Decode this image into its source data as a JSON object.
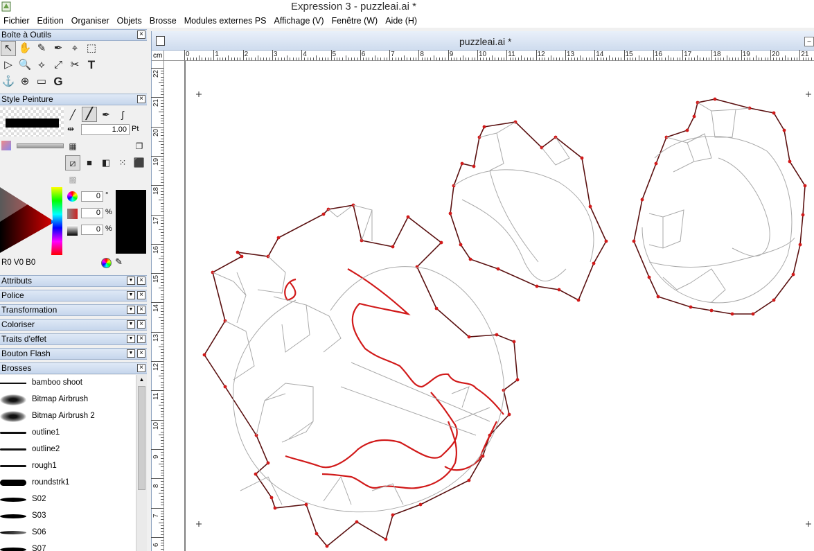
{
  "window": {
    "title": "Expression 3 - puzzleai.ai *"
  },
  "menu": [
    "Fichier",
    "Edition",
    "Organiser",
    "Objets",
    "Brosse",
    "Modules externes PS",
    "Affichage (V)",
    "Fenêtre (W)",
    "Aide (H)"
  ],
  "toolbox": {
    "title": "Boîte à Outils",
    "tools": [
      {
        "name": "selection-arrow-icon",
        "glyph": "↖"
      },
      {
        "name": "hand-icon",
        "glyph": "✋"
      },
      {
        "name": "brush-icon",
        "glyph": "✎"
      },
      {
        "name": "pen-icon",
        "glyph": "✒"
      },
      {
        "name": "add-node-icon",
        "glyph": "⌖"
      },
      {
        "name": "marquee-icon",
        "glyph": "⬚"
      },
      {
        "name": "direct-select-icon",
        "glyph": "▷"
      },
      {
        "name": "zoom-icon",
        "glyph": "🔍"
      },
      {
        "name": "node-edit-icon",
        "glyph": "⟡"
      },
      {
        "name": "transform-icon",
        "glyph": "⤢"
      },
      {
        "name": "scissors-icon",
        "glyph": "✂"
      },
      {
        "name": "text-icon",
        "glyph": "T"
      },
      {
        "name": "anchor-icon",
        "glyph": "⚓"
      },
      {
        "name": "magnifier-plus-icon",
        "glyph": "⊕"
      },
      {
        "name": "rectangle-icon",
        "glyph": "▭"
      },
      {
        "name": "rotate-icon",
        "glyph": "G"
      }
    ]
  },
  "style": {
    "title": "Style Peinture",
    "stroke_width": "1.00",
    "stroke_unit": "Pt",
    "hue_value": "0",
    "hue_unit": "°",
    "sat_value": "0",
    "sat_unit": "%",
    "lum_value": "0",
    "lum_unit": "%",
    "rgb": "R0  V0  B0",
    "current_color": "#000000"
  },
  "panels": [
    "Attributs",
    "Police",
    "Transformation",
    "Coloriser",
    "Traits d'effet",
    "Bouton Flash"
  ],
  "brushes": {
    "title": "Brosses",
    "items": [
      "bamboo shoot",
      "Bitmap Airbrush",
      "Bitmap Airbrush 2",
      "outline1",
      "outline2",
      "rough1",
      "roundstrk1",
      "S02",
      "S03",
      "S06",
      "S07"
    ]
  },
  "document": {
    "title": "puzzleai.ai *",
    "ruler_unit": "cm",
    "h_ticks": [
      "0",
      "1",
      "2",
      "3",
      "4",
      "5",
      "6",
      "7",
      "8",
      "9",
      "10",
      "11",
      "12",
      "13",
      "14",
      "15",
      "16",
      "17",
      "18",
      "19",
      "20",
      "21"
    ],
    "v_ticks": [
      "22",
      "21",
      "20",
      "19",
      "18",
      "17",
      "16",
      "15",
      "14",
      "13",
      "12",
      "11",
      "10",
      "9",
      "8",
      "7",
      "6"
    ]
  },
  "colors": {
    "path_red": "#d11a1a",
    "path_dark": "#5a1010",
    "guide_gray": "#aaaaaa"
  }
}
